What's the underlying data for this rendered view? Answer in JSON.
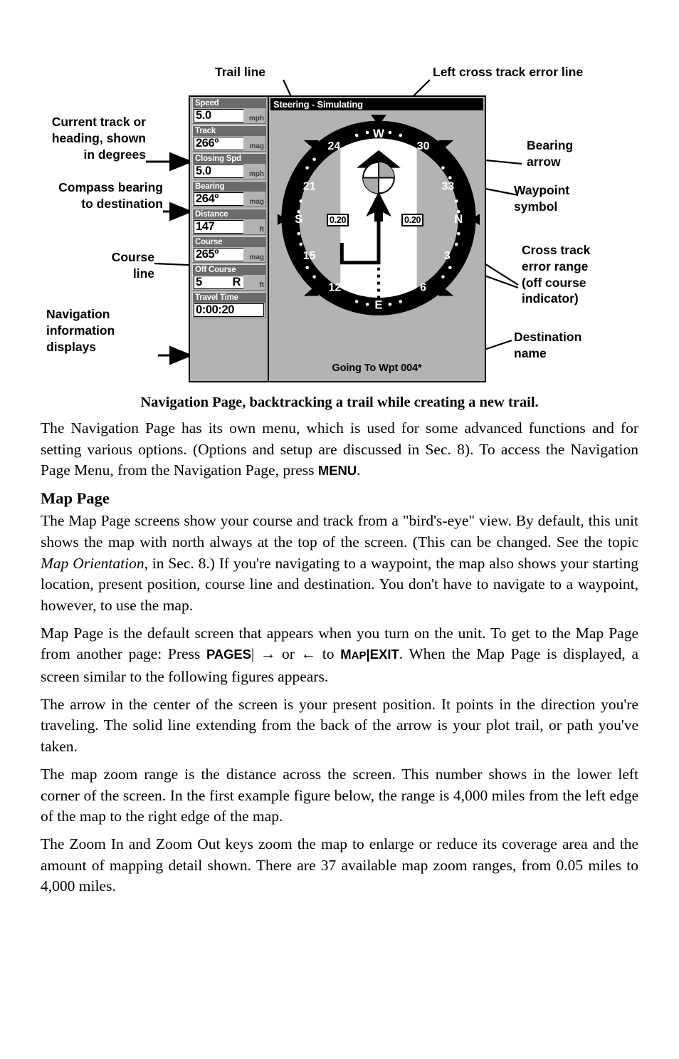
{
  "figure": {
    "callouts": {
      "trail_line": "Trail line",
      "left_cross_track_error_line": "Left cross track error line",
      "current_track": "Current track or\nheading, shown\nin degrees",
      "compass_bearing": "Compass bearing\nto destination",
      "course_line": "Course\nline",
      "navigation_info": "Navigation\ninformation\ndisplays",
      "bearing_arrow": "Bearing\narrow",
      "waypoint_symbol": "Waypoint\nsymbol",
      "cross_track_error_range": "Cross track\nerror range\n(off course\nindicator)",
      "destination_name": "Destination\nname"
    },
    "gps": {
      "title": "Steering - Simulating",
      "destination": "Going To Wpt 004*",
      "nav_boxes": [
        {
          "label": "Speed",
          "value": "5.0",
          "unit": "mph",
          "suffix": ""
        },
        {
          "label": "Track",
          "value": "266º",
          "unit": "mag",
          "suffix": ""
        },
        {
          "label": "Closing Spd",
          "value": "5.0",
          "unit": "mph",
          "suffix": ""
        },
        {
          "label": "Bearing",
          "value": "264º",
          "unit": "mag",
          "suffix": ""
        },
        {
          "label": "Distance",
          "value": "147",
          "unit": "ft",
          "suffix": ""
        },
        {
          "label": "Course",
          "value": "265º",
          "unit": "mag",
          "suffix": ""
        },
        {
          "label": "Off Course",
          "value": "5",
          "unit": "ft",
          "suffix": "R"
        },
        {
          "label": "Travel Time",
          "value": "0:00:20",
          "unit": "",
          "suffix": ""
        }
      ],
      "compass": {
        "cardinals": [
          "W",
          "N",
          "E",
          "S"
        ],
        "numbers": [
          "24",
          "30",
          "33",
          "3",
          "6",
          "12",
          "15",
          "21"
        ],
        "xte_left_label": "0.20",
        "xte_right_label": "0.20"
      },
      "colors": {
        "screen_bg": "#b3b3b3",
        "panel_dark": "#6b6b6b",
        "field_bg": "#ffffff",
        "ink": "#000000"
      }
    }
  },
  "caption": "Navigation Page, backtracking a trail while creating a new trail.",
  "body": {
    "p1_a": "The Navigation Page has its own menu, which is used for some advanced functions and for setting various options. (Options and setup are discussed in Sec. 8). To access the Navigation Page Menu, from the Navigation Page, press ",
    "p1_kbd": "MENU",
    "p1_b": ".",
    "map_page_heading": "Map Page",
    "p2_a": "The Map Page screens show your course and track from a \"bird's-eye\" view. By default, this unit shows the map with north always at the top of the screen. (This can be changed. See the topic ",
    "p2_ital": "Map Orientation",
    "p2_b": ", in Sec. 8.) If you're navigating to a waypoint, the map also shows your starting location, present position, course line and destination. You don't have to navigate to a waypoint, however, to use the map.",
    "p3_a": "Map Page is the default screen that appears when you turn on the unit. To get to the Map Page from another page: Press ",
    "p3_kbd1": "PAGES",
    "p3_mid": "| → or ← to ",
    "p3_kbd2_small": "M",
    "p3_kbd2_rest": "AP",
    "p3_kbd2_sep": "|",
    "p3_kbd3": "EXIT",
    "p3_b": ". When the Map Page is displayed, a screen similar to the following figures appears.",
    "p4": "The arrow in the center of the screen is your present position. It points in the direction you're traveling. The solid line extending from the back of the arrow is your plot trail, or path you've taken.",
    "p5": "The map zoom range is the distance across the screen. This number shows in the lower left corner of the screen. In the first example figure below, the range is 4,000 miles from the left edge of the map to the right edge of the map.",
    "p6": "The Zoom In and Zoom Out keys zoom the map to enlarge or reduce its coverage area and the amount of mapping detail shown. There are 37 available map zoom ranges, from 0.05 miles to 4,000 miles."
  }
}
